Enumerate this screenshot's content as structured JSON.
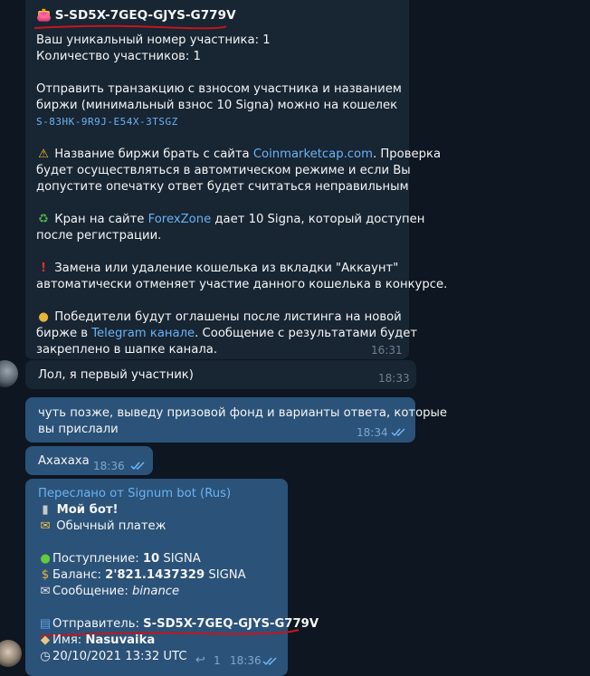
{
  "bot_message": {
    "wallet_id": "S-SD5X-7GEQ-GJYS-G779V",
    "participant_number": "Ваш уникальный номер участника: 1",
    "participant_count": "Количество участников: 1",
    "send_tx_1": "Отправить транзакцию с взносом участника и названием",
    "send_tx_2": "биржи (минимальный взнос 10 Signa) можно на кошелек",
    "target_wallet": "S-83HK-9R9J-E54X-3TSGZ",
    "warn_1a": "Название биржи брать с сайта ",
    "warn_1_link": "Coinmarketcap.com",
    "warn_1b": ". Проверка",
    "warn_2": "будет осуществляться в автомтическом режиме и если Вы",
    "warn_3": "допустите опечатку ответ будет считаться неправильным",
    "faucet_1a": "Кран на сайте ",
    "faucet_1_link": "ForexZone",
    "faucet_1b": " дает 10 Signa, который доступен",
    "faucet_2": "после регистрации.",
    "replace_1": "Замена или удаление кошелька из вкладки \"Аккаунт\"",
    "replace_2": "автоматически отменяет участие данного кошелька в конкурсе.",
    "winners_1": "Победители будут оглашены после листинга на новой",
    "winners_2a": "бирже в ",
    "winners_2_link": "Telegram канале",
    "winners_2b": ". Сообщение с результатами будет",
    "winners_3": "закреплено в шапке канала.",
    "time": "16:31"
  },
  "user_message": {
    "text": "Лол, я первый участник)",
    "time": "18:33"
  },
  "reply_1": {
    "line1": "чуть позже, выведу призовой фонд и варианты ответа, которые",
    "line2": "вы прислали",
    "time": "18:34"
  },
  "reply_2": {
    "text": "Ахахаха",
    "time": "18:36"
  },
  "forwarded": {
    "header": "Переслано от Signum bot (Rus)",
    "title": "Мой бот!",
    "payment_type": "Обычный платеж",
    "income_label": "Поступление: ",
    "income_value": "10",
    "income_unit": " SIGNA",
    "balance_label": "Баланс: ",
    "balance_value": "2'821.1437329",
    "balance_unit": " SIGNA",
    "message_label": "Сообщение: ",
    "message_value": "binance",
    "sender_label": "Отправитель: ",
    "sender_value": "S-SD5X-7GEQ-GJYS-G779V",
    "name_label": "Имя: ",
    "name_value": "Nasuvaika",
    "datetime": "20/10/2021 13:32 UTC",
    "replies_count": "1",
    "time": "18:36"
  },
  "colors": {
    "background": "#0e1621",
    "incoming_bubble": "#182533",
    "outgoing_bubble": "#2b5278",
    "link": "#6ab3f3",
    "red_underline": "#c4161c"
  },
  "icons": {
    "wallet_prefix": "purse-icon",
    "warning": "warning-icon",
    "faucet": "recycle-icon",
    "replace": "exclamation-icon",
    "winners": "medal-icon",
    "title": "robot-icon",
    "payment": "money-wings-icon",
    "income": "green-circle-icon",
    "balance": "money-bag-icon",
    "message": "envelope-icon",
    "sender": "outbox-icon",
    "name": "tag-icon",
    "datetime": "clock-icon",
    "reply": "reply-arrow-icon",
    "read": "double-check-icon"
  }
}
